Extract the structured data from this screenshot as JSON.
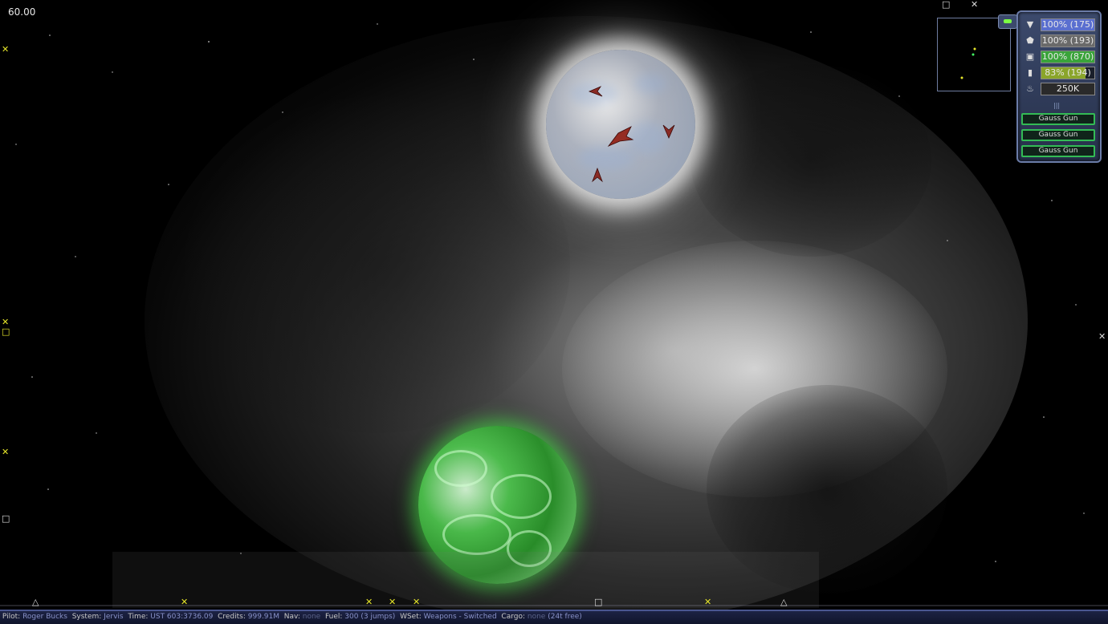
{
  "fps": "60.00",
  "hud": {
    "stats": [
      {
        "icon": "shield-icon",
        "glyph": "▼",
        "text": "100% (175)",
        "fill": 1.0,
        "color": "#5a6fd0"
      },
      {
        "icon": "armor-icon",
        "glyph": "⬟",
        "text": "100% (193)",
        "fill": 1.0,
        "color": "#6a6a6a"
      },
      {
        "icon": "hull-icon",
        "glyph": "▣",
        "text": "100% (870)",
        "fill": 1.0,
        "color": "#3aa43a"
      },
      {
        "icon": "energy-icon",
        "glyph": "▮",
        "text": "83% (194)",
        "fill": 0.83,
        "color": "#8aa52a"
      },
      {
        "icon": "speed-icon",
        "glyph": "♨",
        "text": "250K",
        "fill": 1.0,
        "color": "#2a2a2a"
      }
    ],
    "weapons": [
      "Gauss Gun",
      "Gauss Gun",
      "Gauss Gun"
    ],
    "divider": "|||"
  },
  "status": {
    "pilot_label": "Pilot:",
    "pilot": "Roger Bucks",
    "system_label": "System:",
    "system": "Jervis",
    "time_label": "Time:",
    "time": "UST 603:3736.09",
    "credits_label": "Credits:",
    "credits": "999.91M",
    "nav_label": "Nav:",
    "nav": "none",
    "fuel_label": "Fuel:",
    "fuel": "300 (3 jumps)",
    "wset_label": "WSet:",
    "wset": "Weapons - Switched",
    "cargo_label": "Cargo:",
    "cargo": "none",
    "cargo_free": "(24t free)"
  },
  "colors": {
    "marker": "#e6e62a",
    "status_value": "#8891c8",
    "weapon_border": "#33bb55"
  }
}
